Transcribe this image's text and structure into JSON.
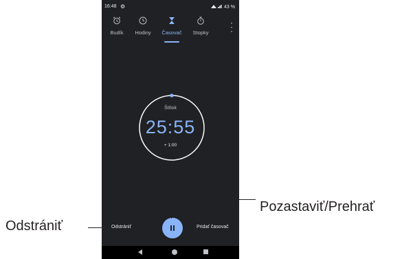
{
  "status_bar": {
    "time": "16:48",
    "right": "43 %"
  },
  "tabs": [
    {
      "label": "Budík",
      "icon": "alarm-icon"
    },
    {
      "label": "Hodiny",
      "icon": "clock-icon"
    },
    {
      "label": "Časovač",
      "icon": "hourglass-icon",
      "active": true
    },
    {
      "label": "Stopky",
      "icon": "stopwatch-icon"
    }
  ],
  "timer": {
    "label": "Štítok",
    "value": "25:55",
    "add_minute": "+ 1:00"
  },
  "controls": {
    "delete": "Odstrániť",
    "add_timer": "Pridať časovač",
    "play_pause_icon": "pause-icon"
  },
  "callouts": {
    "left": "Odstrániť",
    "right": "Pozastaviť/Prehrať"
  },
  "colors": {
    "accent": "#8ab4f8",
    "background": "#202124"
  }
}
